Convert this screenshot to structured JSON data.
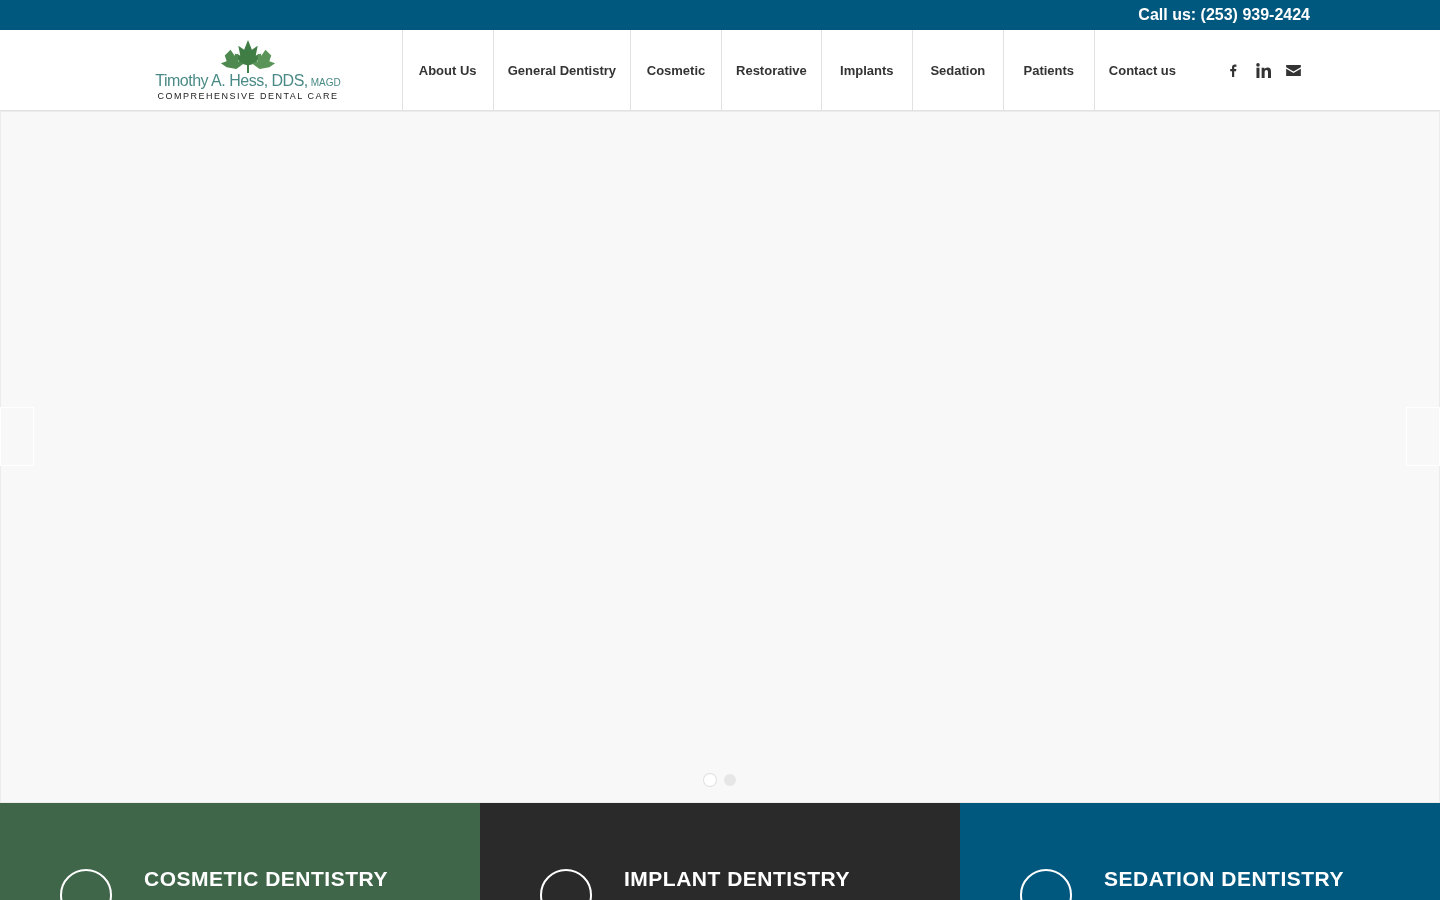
{
  "top_bar": {
    "phone": "Call us: (253) 939-2424"
  },
  "logo": {
    "name": "Timothy A. Hess, DDS,",
    "suffix": "MAGD",
    "tagline": "COMPREHENSIVE DENTAL CARE"
  },
  "nav": [
    {
      "label": "About Us",
      "selected": false
    },
    {
      "label": "General Dentistry",
      "selected": false
    },
    {
      "label": "Cosmetic",
      "selected": false
    },
    {
      "label": "Restorative",
      "selected": false
    },
    {
      "label": "Implants",
      "selected": false
    },
    {
      "label": "Sedation",
      "selected": false
    },
    {
      "label": "Patients",
      "selected": false
    },
    {
      "label": "Contact us",
      "selected": false
    }
  ],
  "social": [
    {
      "kind": "facebook"
    },
    {
      "kind": "linkedin"
    },
    {
      "kind": "mail"
    }
  ],
  "slider": {
    "dots": [
      {
        "selected": true
      },
      {
        "selected": false
      }
    ]
  },
  "features": [
    {
      "title": "COSMETIC DENTISTRY",
      "color": "#3f6649"
    },
    {
      "title": "IMPLANT DENTISTRY",
      "color": "#2a2a2a"
    },
    {
      "title": "SEDATION DENTISTRY",
      "color": "#00587f"
    }
  ]
}
